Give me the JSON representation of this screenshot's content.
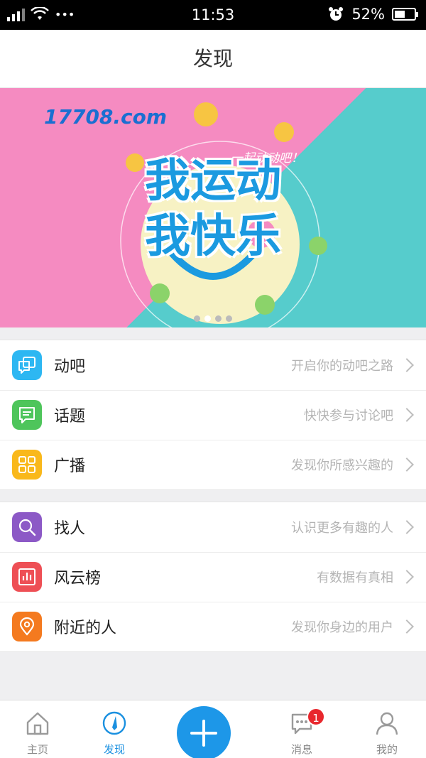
{
  "status_bar": {
    "time": "11:53",
    "battery": "52%",
    "battery_level": 0.52,
    "dots": "•••"
  },
  "header": {
    "title": "发现"
  },
  "banner": {
    "logo_text": "17708.com",
    "tagline": "一起动动吧！",
    "headline_line1": "我运动",
    "headline_line2": "我快乐",
    "slide_count": 4,
    "active_slide": 1
  },
  "menu_groups": [
    [
      {
        "label": "动吧",
        "hint": "开启你的动吧之路",
        "icon": "chat-square-icon",
        "color": "#2db7f2"
      },
      {
        "label": "话题",
        "hint": "快快参与讨论吧",
        "icon": "message-icon",
        "color": "#4ec55b"
      },
      {
        "label": "广播",
        "hint": "发现你所感兴趣的",
        "icon": "grid-icon",
        "color": "#f9b81b"
      }
    ],
    [
      {
        "label": "找人",
        "hint": "认识更多有趣的人",
        "icon": "search-icon",
        "color": "#8c59c6"
      },
      {
        "label": "风云榜",
        "hint": "有数据有真相",
        "icon": "chart-icon",
        "color": "#ee4f55"
      },
      {
        "label": "附近的人",
        "hint": "发现你身边的用户",
        "icon": "location-icon",
        "color": "#f47a1f"
      }
    ]
  ],
  "tabbar": {
    "home": "主页",
    "discover": "发现",
    "messages": "消息",
    "messages_badge": "1",
    "mine": "我的"
  }
}
